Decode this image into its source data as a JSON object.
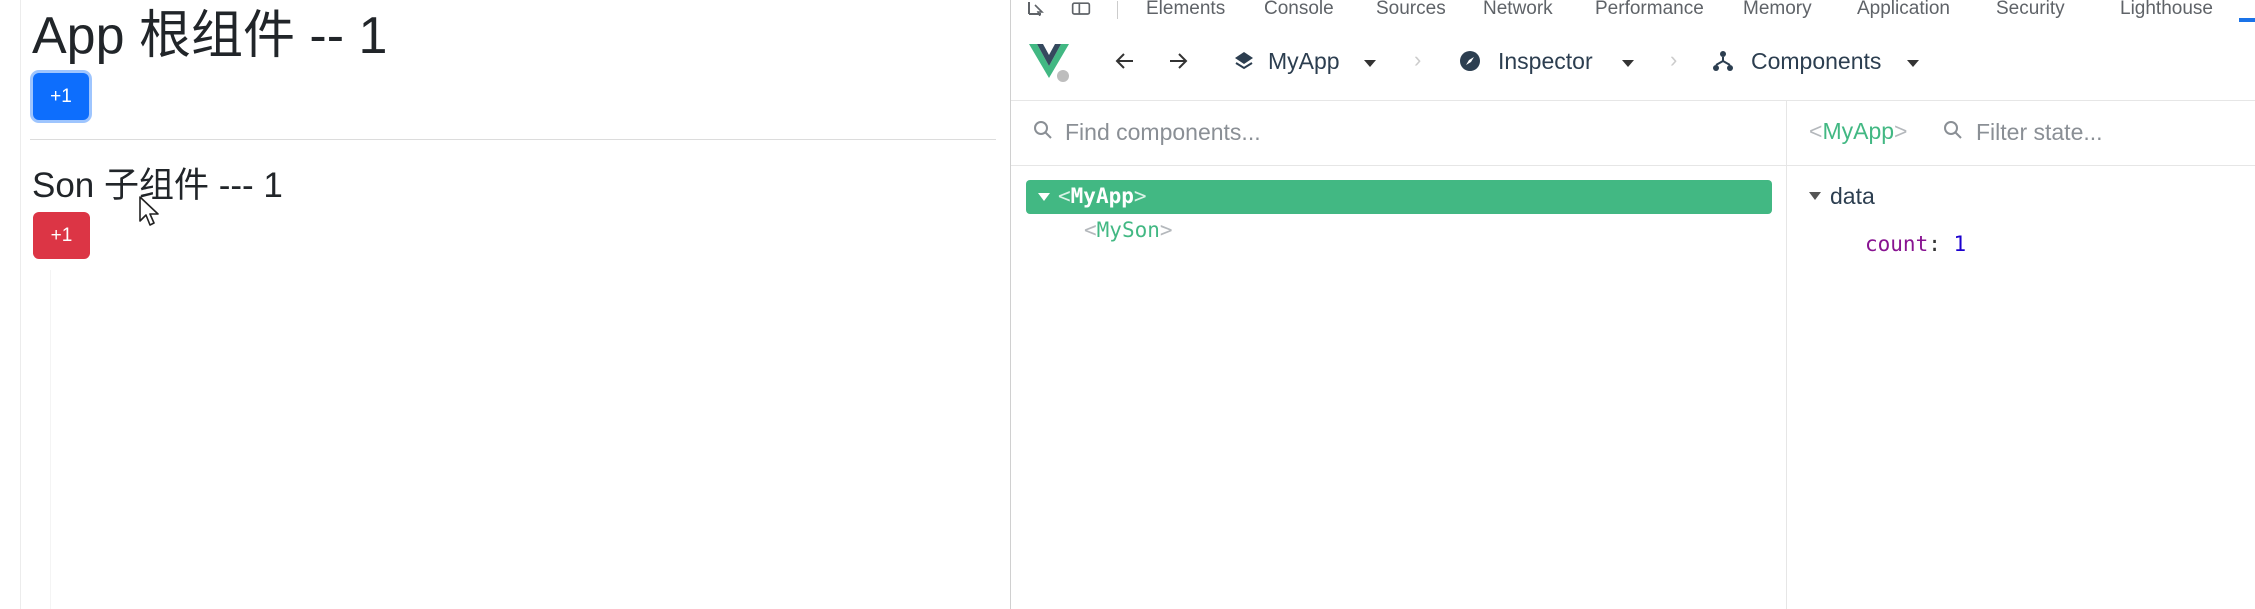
{
  "app": {
    "root_title": "App 根组件 -- 1",
    "root_button": "+1",
    "child_title": "Son 子组件 --- 1",
    "child_button": "+1"
  },
  "devtools": {
    "tabs": [
      "Elements",
      "Console",
      "Sources",
      "Network",
      "Performance",
      "Memory",
      "Application",
      "Security",
      "Lighthouse"
    ],
    "toolbar": {
      "app_name": "MyApp",
      "mode": "Inspector",
      "view": "Components"
    },
    "tree": {
      "search_placeholder": "Find components...",
      "root": "MyApp",
      "child": "MySon"
    },
    "state": {
      "selected_component": "MyApp",
      "filter_placeholder": "Filter state...",
      "section": "data",
      "key": "count",
      "value": "1"
    }
  },
  "colors": {
    "primary_button": "#0d6efd",
    "danger_button": "#dc3545",
    "vue_green": "#42b883",
    "devtools_active": "#1a73e8"
  }
}
